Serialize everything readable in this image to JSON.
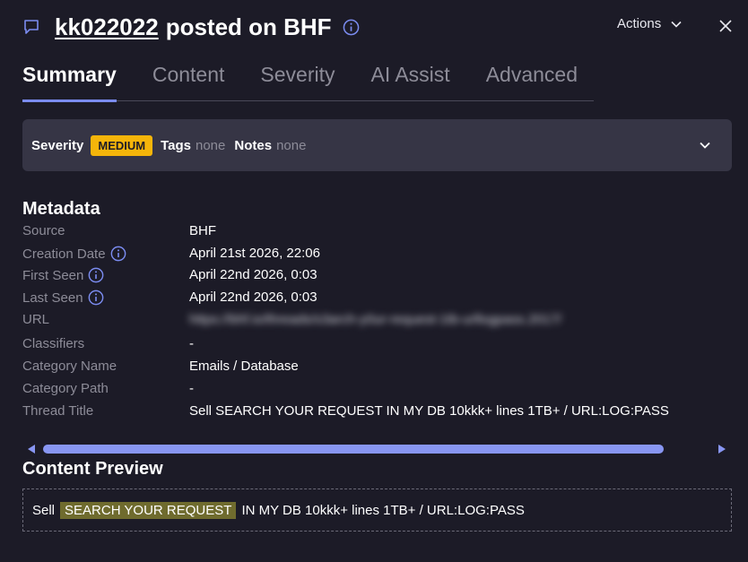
{
  "header": {
    "user": "kk022022",
    "title_rest": "posted on BHF",
    "actions_label": "Actions"
  },
  "tabs": [
    {
      "label": "Summary",
      "active": true
    },
    {
      "label": "Content",
      "active": false
    },
    {
      "label": "Severity",
      "active": false
    },
    {
      "label": "AI Assist",
      "active": false
    },
    {
      "label": "Advanced",
      "active": false
    }
  ],
  "severity_bar": {
    "severity_label": "Severity",
    "severity_value": "MEDIUM",
    "tags_label": "Tags",
    "tags_value": "none",
    "notes_label": "Notes",
    "notes_value": "none"
  },
  "metadata": {
    "title": "Metadata",
    "rows": [
      {
        "key": "Source",
        "value": "BHF",
        "info": false
      },
      {
        "key": "Creation Date",
        "value": "April 21st 2026, 22:06",
        "info": true
      },
      {
        "key": "First Seen",
        "value": "April 22nd 2026, 0:03",
        "info": true
      },
      {
        "key": "Last Seen",
        "value": "April 22nd 2026, 0:03",
        "info": true
      },
      {
        "key": "URL",
        "value": "https://bhf.io/threads/s3arch-y0ur-request-1tb-urllogpass.2017/",
        "info": false,
        "blurred": true
      },
      {
        "key": "Classifiers",
        "value": "-",
        "info": false
      },
      {
        "key": "Category Name",
        "value": "Emails / Database",
        "info": false
      },
      {
        "key": "Category Path",
        "value": "-",
        "info": false
      },
      {
        "key": "Thread Title",
        "value": "Sell SEARCH YOUR REQUEST IN MY DB 10kkk+ lines 1TB+ / URL:LOG:PASS",
        "info": false
      }
    ]
  },
  "content_preview": {
    "title": "Content Preview",
    "before": "Sell",
    "highlight": "SEARCH YOUR REQUEST",
    "after": "IN MY DB 10kkk+ lines 1TB+ / URL:LOG:PASS"
  },
  "colors": {
    "background": "#1c1b27",
    "accent": "#7b8cf0",
    "severity_medium": "#f5b50a",
    "highlight": "#6f6b2e"
  }
}
